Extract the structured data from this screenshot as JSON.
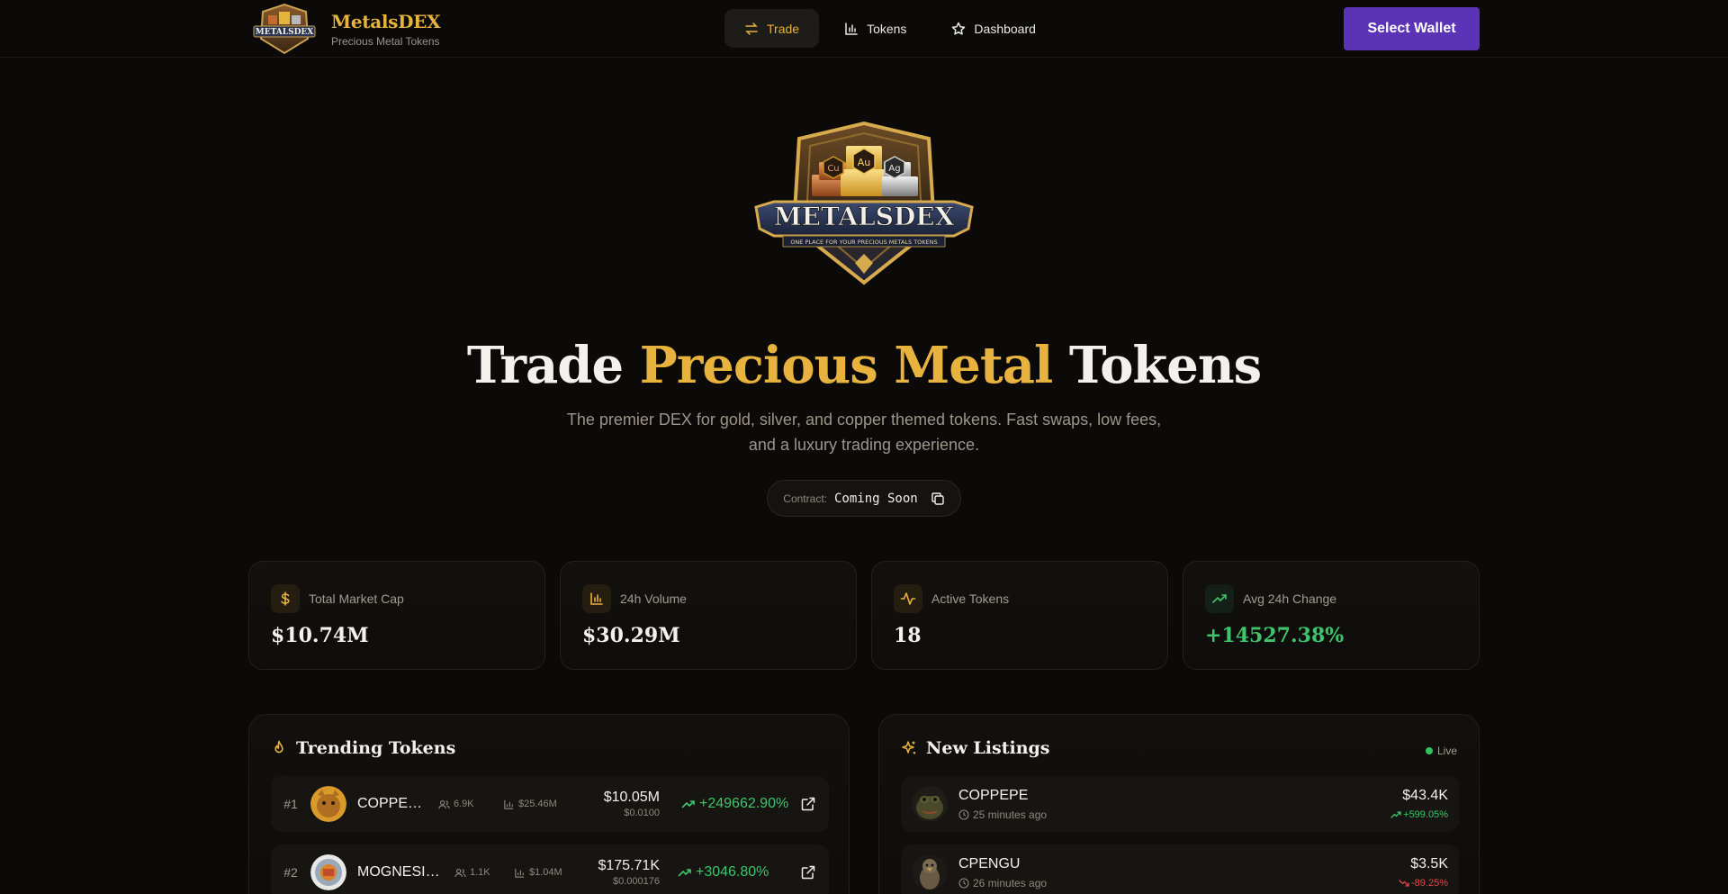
{
  "brand": {
    "name": "MetalsDEX",
    "tagline": "Precious Metal Tokens"
  },
  "nav": {
    "items": [
      {
        "label": "Trade",
        "icon": "swap-icon",
        "active": true
      },
      {
        "label": "Tokens",
        "icon": "bar-chart-icon",
        "active": false
      },
      {
        "label": "Dashboard",
        "icon": "star-icon",
        "active": false
      }
    ]
  },
  "wallet_button": "Select Wallet",
  "hero": {
    "title_part1": "Trade ",
    "title_highlight": "Precious Metal",
    "title_part2": " Tokens",
    "subtitle": "The premier DEX for gold, silver, and copper themed tokens. Fast swaps, low fees, and a luxury trading experience.",
    "logo_text": "METALSDEX",
    "logo_banner": "ONE PLACE FOR YOUR PRECIOUS METALS TOKENS",
    "logo_elements": [
      "Cu",
      "Au",
      "Ag"
    ]
  },
  "contract": {
    "label": "Contract:",
    "value": "Coming Soon"
  },
  "stats": [
    {
      "label": "Total Market Cap",
      "value": "$10.74M",
      "icon": "dollar-icon"
    },
    {
      "label": "24h Volume",
      "value": "$30.29M",
      "icon": "bar-chart-icon"
    },
    {
      "label": "Active Tokens",
      "value": "18",
      "icon": "activity-icon"
    },
    {
      "label": "Avg 24h Change",
      "value": "+14527.38%",
      "icon": "trending-up-icon"
    }
  ],
  "trending": {
    "title": "Trending Tokens",
    "rows": [
      {
        "rank": "#1",
        "name": "COPPERI...",
        "holders": "6.9K",
        "volume": "$25.46M",
        "price": "$10.05M",
        "price_sub": "$0.0100",
        "change": "+249662.90%"
      },
      {
        "rank": "#2",
        "name": "MOGNESIU...",
        "holders": "1.1K",
        "volume": "$1.04M",
        "price": "$175.71K",
        "price_sub": "$0.000176",
        "change": "+3046.80%"
      }
    ]
  },
  "listings": {
    "title": "New Listings",
    "live_label": "Live",
    "rows": [
      {
        "name": "COPPEPE",
        "time": "25 minutes ago",
        "price": "$43.4K",
        "change": "+599.05%",
        "direction": "up"
      },
      {
        "name": "CPENGU",
        "time": "26 minutes ago",
        "price": "$3.5K",
        "change": "-89.25%",
        "direction": "down"
      }
    ]
  },
  "colors": {
    "gold": "#e7b23e",
    "wallet": "#5b33b6",
    "positive": "#3ec56a",
    "negative": "#e04848",
    "background": "#0b0a09"
  }
}
